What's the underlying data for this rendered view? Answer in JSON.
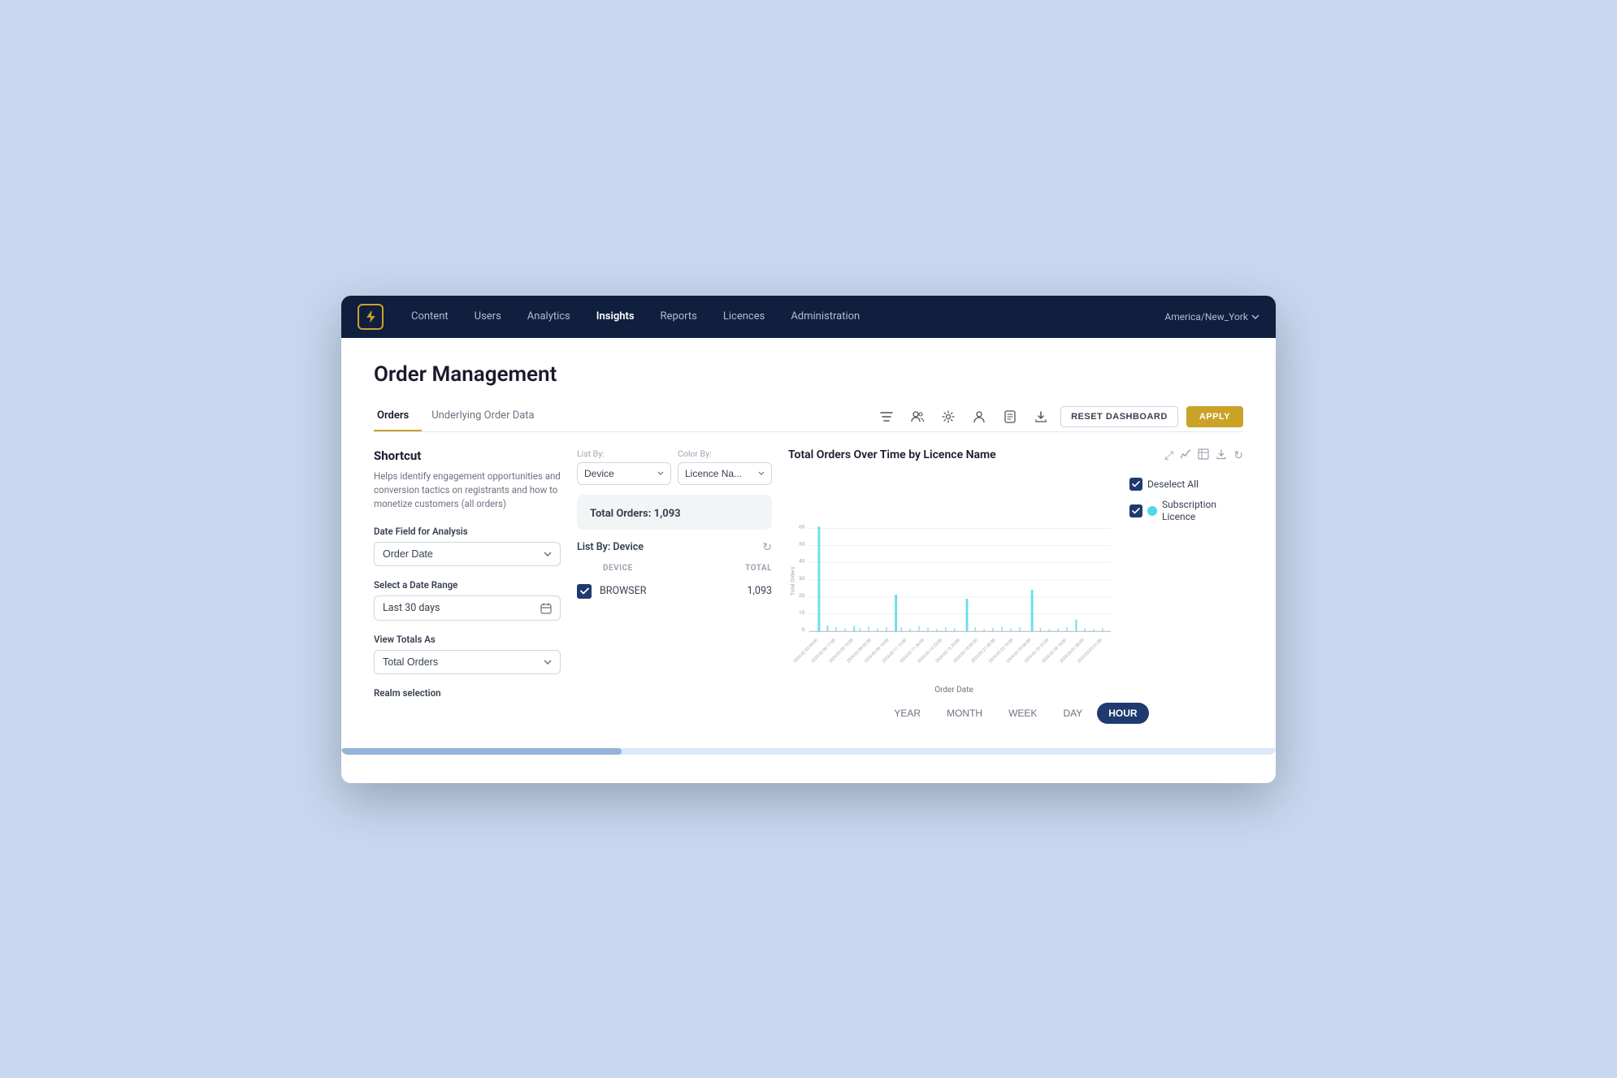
{
  "nav": {
    "items": [
      {
        "label": "Content",
        "active": false
      },
      {
        "label": "Users",
        "active": false
      },
      {
        "label": "Analytics",
        "active": false
      },
      {
        "label": "Insights",
        "active": true
      },
      {
        "label": "Reports",
        "active": false
      },
      {
        "label": "Licences",
        "active": false
      },
      {
        "label": "Administration",
        "active": false
      }
    ],
    "timezone": "America/New_York",
    "logo_icon": "bolt"
  },
  "page": {
    "title": "Order Management"
  },
  "tabs": {
    "items": [
      {
        "label": "Orders",
        "active": true
      },
      {
        "label": "Underlying Order Data",
        "active": false
      }
    ]
  },
  "toolbar": {
    "reset_label": "RESET DASHBOARD",
    "apply_label": "APPLY"
  },
  "sidebar": {
    "shortcut_title": "Shortcut",
    "shortcut_desc": "Helps identify engagement opportunities and conversion tactics on registrants and how to monetize customers (all orders)",
    "date_field_label": "Date Field for Analysis",
    "date_field_value": "Order Date",
    "date_range_label": "Select a Date Range",
    "date_range_value": "Last 30 days",
    "view_totals_label": "View Totals As",
    "view_totals_value": "Total Orders",
    "realm_label": "Realm selection"
  },
  "center": {
    "list_by_label": "List By:",
    "list_by_value": "Device",
    "color_by_label": "Color By:",
    "color_by_value": "Licence Na...",
    "total_orders_label": "Total Orders:",
    "total_orders_value": "1,093",
    "list_by_device_title": "List By: Device",
    "table_headers": [
      "DEVICE",
      "TOTAL"
    ],
    "devices": [
      {
        "name": "BROWSER",
        "total": "1,093",
        "checked": true
      }
    ]
  },
  "chart": {
    "title": "Total Orders Over Time by Licence Name",
    "x_axis_label": "Order Date",
    "y_axis_label": "Total Orders",
    "y_ticks": [
      0,
      10,
      20,
      30,
      40,
      50,
      60
    ],
    "legend": {
      "deselect_all_label": "Deselect All",
      "items": [
        {
          "label": "Subscription\nLicence",
          "color": "#4dd9e8"
        }
      ]
    },
    "time_buttons": [
      "YEAR",
      "MONTH",
      "WEEK",
      "DAY",
      "HOUR"
    ],
    "active_time": "HOUR",
    "x_labels": [
      "2024-02-03 04:00",
      "2024-02-04 17:00",
      "2024-02-05 10:00",
      "2024-02-08 03:00",
      "2024-02-09 10:00",
      "2024-02-11 13:00",
      "2024-02-11 06:00",
      "2024-02-14 23:00",
      "2024-02-15 20:00",
      "2024-02-18 09:00",
      "2024-02-21 00:00",
      "2024-02-22 19:00",
      "2024-02-25 06:00",
      "2024-02-25 22:00",
      "2024-02-28 15:00",
      "2024-03-01 08:00",
      "2024-03-03 01:00"
    ]
  }
}
